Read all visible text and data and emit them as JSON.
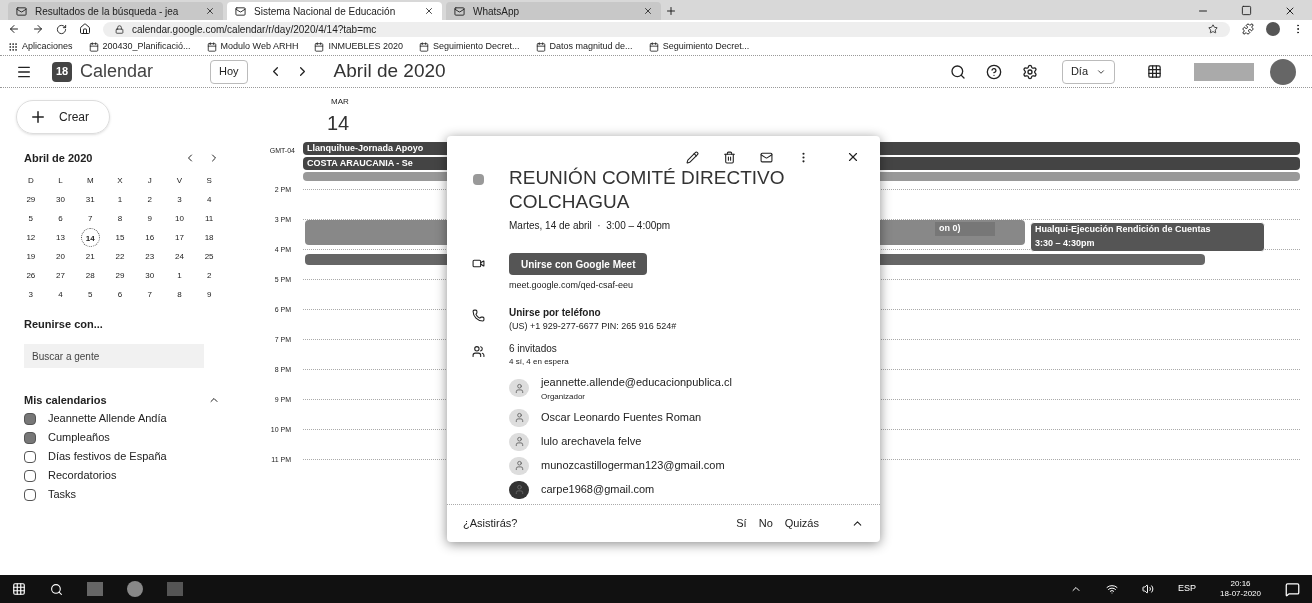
{
  "browser": {
    "tabs": [
      {
        "title": "Resultados de la búsqueda - jea",
        "selected": false
      },
      {
        "title": "Sistema Nacional de Educación",
        "selected": true
      },
      {
        "title": "WhatsApp",
        "selected": false
      }
    ],
    "url": "calendar.google.com/calendar/r/day/2020/4/14?tab=mc",
    "bookmarks": [
      "Aplicaciones",
      "200430_Planificació...",
      "Modulo Web ARHH",
      "INMUEBLES 2020",
      "Seguimiento Decret...",
      "Datos magnitud de...",
      "Seguimiento Decret..."
    ]
  },
  "header": {
    "app_name": "Calendar",
    "logo_day": "18",
    "today_button": "Hoy",
    "period": "Abril de 2020",
    "view_select": "Día"
  },
  "sidebar": {
    "create_button": "Crear",
    "mini_calendar": {
      "month": "Abril de 2020",
      "weekdays": [
        "D",
        "L",
        "M",
        "X",
        "J",
        "V",
        "S"
      ],
      "days": [
        {
          "label": "29",
          "selected": false
        },
        {
          "label": "30",
          "selected": false
        },
        {
          "label": "31",
          "selected": false
        },
        {
          "label": "1",
          "selected": false
        },
        {
          "label": "2",
          "selected": false
        },
        {
          "label": "3",
          "selected": false
        },
        {
          "label": "4",
          "selected": false
        },
        {
          "label": "5",
          "selected": false
        },
        {
          "label": "6",
          "selected": false
        },
        {
          "label": "7",
          "selected": false
        },
        {
          "label": "8",
          "selected": false
        },
        {
          "label": "9",
          "selected": false
        },
        {
          "label": "10",
          "selected": false
        },
        {
          "label": "11",
          "selected": false
        },
        {
          "label": "12",
          "selected": false
        },
        {
          "label": "13",
          "selected": false
        },
        {
          "label": "14",
          "selected": true
        },
        {
          "label": "15",
          "selected": false
        },
        {
          "label": "16",
          "selected": false
        },
        {
          "label": "17",
          "selected": false
        },
        {
          "label": "18",
          "selected": false
        },
        {
          "label": "19",
          "selected": false
        },
        {
          "label": "20",
          "selected": false
        },
        {
          "label": "21",
          "selected": false
        },
        {
          "label": "22",
          "selected": false
        },
        {
          "label": "23",
          "selected": false
        },
        {
          "label": "24",
          "selected": false
        },
        {
          "label": "25",
          "selected": false
        },
        {
          "label": "26",
          "selected": false
        },
        {
          "label": "27",
          "selected": false
        },
        {
          "label": "28",
          "selected": false
        },
        {
          "label": "29",
          "selected": false
        },
        {
          "label": "30",
          "selected": false
        },
        {
          "label": "1",
          "selected": false
        },
        {
          "label": "2",
          "selected": false
        },
        {
          "label": "3",
          "selected": false
        },
        {
          "label": "4",
          "selected": false
        },
        {
          "label": "5",
          "selected": false
        },
        {
          "label": "6",
          "selected": false
        },
        {
          "label": "7",
          "selected": false
        },
        {
          "label": "8",
          "selected": false
        },
        {
          "label": "9",
          "selected": false
        }
      ]
    },
    "meet_heading": "Reunirse con...",
    "people_search": {
      "placeholder": "Buscar a gente"
    },
    "calendars_heading": "Mis calendarios",
    "calendars": [
      {
        "name": "Jeannette Allende Andía",
        "checked": true
      },
      {
        "name": "Cumpleaños",
        "checked": true
      },
      {
        "name": "Días festivos de España",
        "checked": false
      },
      {
        "name": "Recordatorios",
        "checked": false
      },
      {
        "name": "Tasks",
        "checked": false
      }
    ]
  },
  "day_view": {
    "weekday": "MAR",
    "day": "14",
    "timezone": "GMT-04",
    "all_day_events": [
      "Llanquihue-Jornada Apoyo",
      "COSTA ARAUCANIA - Se"
    ],
    "hours": [
      "2 PM",
      "3 PM",
      "4 PM",
      "5 PM",
      "6 PM",
      "7 PM",
      "8 PM",
      "9 PM",
      "10 PM",
      "11 PM"
    ],
    "events": [
      {
        "title": "on 0)"
      },
      {
        "title": "Hualqui-Ejecución Rendición de Cuentas",
        "time": "3:30 – 4:30pm"
      }
    ]
  },
  "popup": {
    "title": "REUNIÓN COMITÉ DIRECTIVO COLCHAGUA",
    "when": "Martes, 14 de abril  ·  3:00 – 4:00pm",
    "meet_button": "Unirse con Google Meet",
    "meet_link": "meet.google.com/qed-csaf-eeu",
    "phone_heading": "Unirse por teléfono",
    "phone": "(US) +1 929-277-6677 PIN: 265 916 524#",
    "guests_count": "6 invitados",
    "guests_summary": "4 sí, 4 en espera",
    "guests": [
      {
        "name": "jeannette.allende@educacionpublica.cl",
        "role": "Organizador"
      },
      {
        "name": "Oscar Leonardo Fuentes Roman"
      },
      {
        "name": "lulo arechavela felve"
      },
      {
        "name": "munozcastillogerman123@gmail.com"
      },
      {
        "name": "carpe1968@gmail.com"
      }
    ],
    "rsvp_question": "¿Asistirás?",
    "rsvp_options": [
      "Sí",
      "No",
      "Quizás"
    ]
  },
  "taskbar": {
    "language": "ESP",
    "time": "20:16",
    "date": "18-07-2020"
  }
}
